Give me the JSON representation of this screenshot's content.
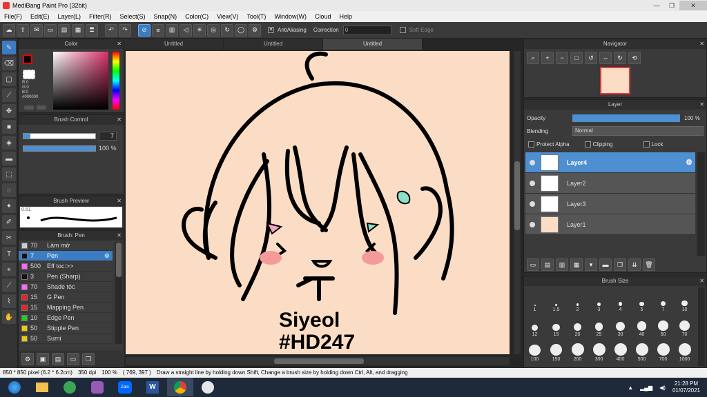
{
  "app": {
    "title": "MediBang Paint Pro (32bit)"
  },
  "menu": [
    "File(F)",
    "Edit(E)",
    "Layer(L)",
    "Filter(R)",
    "Select(S)",
    "Snap(N)",
    "Color(C)",
    "View(V)",
    "Tool(T)",
    "Window(W)",
    "Cloud",
    "Help"
  ],
  "toolbar": {
    "antialiasing_label": "AntiAliasing",
    "correction_label": "Correction",
    "correction_value": "0",
    "soft_edge_label": "Soft Edge"
  },
  "color_panel": {
    "title": "Color",
    "r": "R:0",
    "g": "G:0",
    "b": "B:0",
    "hex": "#000000"
  },
  "brush_control": {
    "title": "Brush Control",
    "size": "7",
    "opacity": "100 %"
  },
  "brush_preview": {
    "title": "Brush Preview",
    "size_label": "0.51"
  },
  "brush_panel": {
    "title": "Brush: Pen",
    "items": [
      {
        "size": "70",
        "name": "Làm mờ",
        "color": "#cccccc"
      },
      {
        "size": "7",
        "name": "Pen",
        "color": "#111111"
      },
      {
        "size": "500",
        "name": "Eff toc:>>",
        "color": "#ff66ff"
      },
      {
        "size": "3",
        "name": "Pen (Sharp)",
        "color": "#111111"
      },
      {
        "size": "70",
        "name": "Shade tóc",
        "color": "#ff66ff"
      },
      {
        "size": "15",
        "name": "G Pen",
        "color": "#ee2222"
      },
      {
        "size": "15",
        "name": "Mapping Pen",
        "color": "#ee2222"
      },
      {
        "size": "10",
        "name": "Edge Pen",
        "color": "#22cc22"
      },
      {
        "size": "50",
        "name": "Stipple Pen",
        "color": "#eecc00"
      },
      {
        "size": "50",
        "name": "Sumi",
        "color": "#eecc00"
      }
    ]
  },
  "tabs": [
    "Untitled",
    "Untitled",
    "Untitled"
  ],
  "canvas_text": {
    "line1": "Siyeol",
    "line2": "#HD247"
  },
  "navigator": {
    "title": "Navigator"
  },
  "layer_panel": {
    "title": "Layer",
    "opacity_label": "Opacity",
    "opacity_value": "100 %",
    "blending_label": "Blending",
    "blending_value": "Normal",
    "protect_alpha": "Protect Alpha",
    "clipping": "Clipping",
    "lock": "Lock",
    "layers": [
      "Layer4",
      "Layer2",
      "Layer3",
      "Layer1"
    ]
  },
  "brush_size_panel": {
    "title": "Brush Size",
    "sizes": [
      "1",
      "1.5",
      "2",
      "3",
      "4",
      "5",
      "7",
      "10",
      "12",
      "15",
      "20",
      "25",
      "30",
      "40",
      "50",
      "70",
      "100",
      "150",
      "200",
      "300",
      "400",
      "500",
      "700",
      "1000"
    ]
  },
  "status": {
    "size": "850 * 850 pixel  (6.2 * 6.2cm)",
    "dpi": "350 dpi",
    "zoom": "100 %",
    "coords": "( 769, 397 )",
    "hint": "Draw a straight line by holding down Shift, Change a brush size by holding down Ctrl, Alt, and dragging"
  },
  "taskbar": {
    "zalo": "Zalo",
    "time": "21:28 PM",
    "date": "01/07/2021"
  }
}
